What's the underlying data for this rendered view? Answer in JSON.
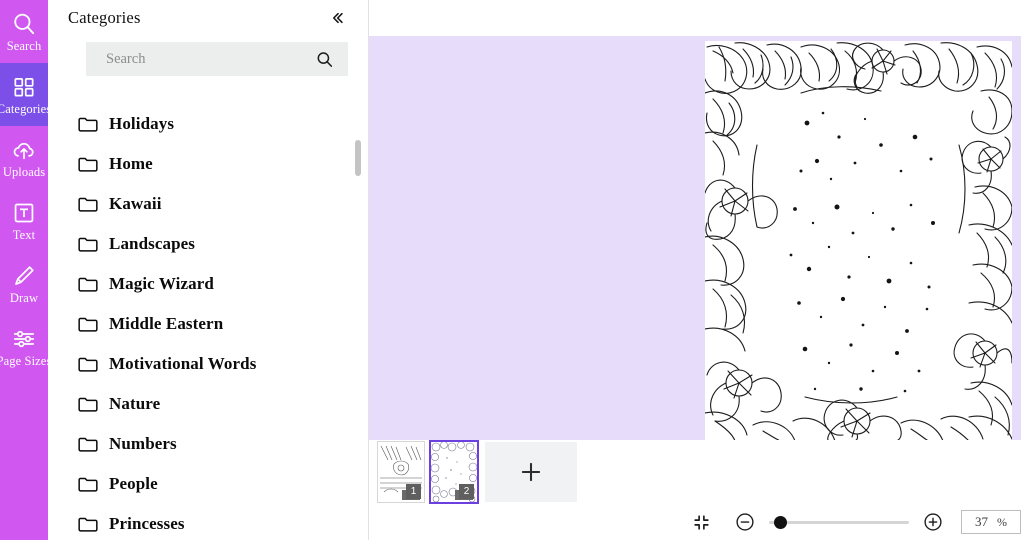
{
  "rail": {
    "items": [
      {
        "label": "Search",
        "icon": "search-icon",
        "active": false
      },
      {
        "label": "Categories",
        "icon": "grid-icon",
        "active": true
      },
      {
        "label": "Uploads",
        "icon": "cloud-upload-icon",
        "active": false
      },
      {
        "label": "Text",
        "icon": "text-box-icon",
        "active": false
      },
      {
        "label": "Draw",
        "icon": "pencil-icon",
        "active": false
      },
      {
        "label": "Page Sizes",
        "icon": "sliders-icon",
        "active": false
      }
    ],
    "active_color": "#7b4fe8",
    "background_color": "#d058f0"
  },
  "panel": {
    "title": "Categories",
    "collapse_icon": "chevron-double-left-icon",
    "search": {
      "placeholder": "Search",
      "value": "",
      "icon": "search-icon"
    },
    "categories": [
      {
        "label": "Holidays",
        "icon": "folder-icon"
      },
      {
        "label": "Home",
        "icon": "folder-icon"
      },
      {
        "label": "Kawaii",
        "icon": "folder-icon"
      },
      {
        "label": "Landscapes",
        "icon": "folder-icon"
      },
      {
        "label": "Magic Wizard",
        "icon": "folder-icon"
      },
      {
        "label": "Middle Eastern",
        "icon": "folder-icon"
      },
      {
        "label": "Motivational Words",
        "icon": "folder-icon"
      },
      {
        "label": "Nature",
        "icon": "folder-icon"
      },
      {
        "label": "Numbers",
        "icon": "folder-icon"
      },
      {
        "label": "People",
        "icon": "folder-icon"
      },
      {
        "label": "Princesses",
        "icon": "folder-icon"
      }
    ]
  },
  "workspace": {
    "background_color": "#e7dcf9",
    "canvas_background": "#ffffff",
    "artwork_description": "floral line-art coloring page border"
  },
  "pages": {
    "items": [
      {
        "number": "1",
        "selected": false
      },
      {
        "number": "2",
        "selected": true
      }
    ],
    "add_label": "+",
    "add_icon": "plus-icon",
    "selected_border_color": "#6b3fe0"
  },
  "zoombar": {
    "fit_icon": "fit-to-screen-icon",
    "zoom_out_icon": "minus-circle-icon",
    "zoom_in_icon": "plus-circle-icon",
    "slider_value": 5,
    "zoom_value": "37",
    "zoom_unit": "%"
  }
}
